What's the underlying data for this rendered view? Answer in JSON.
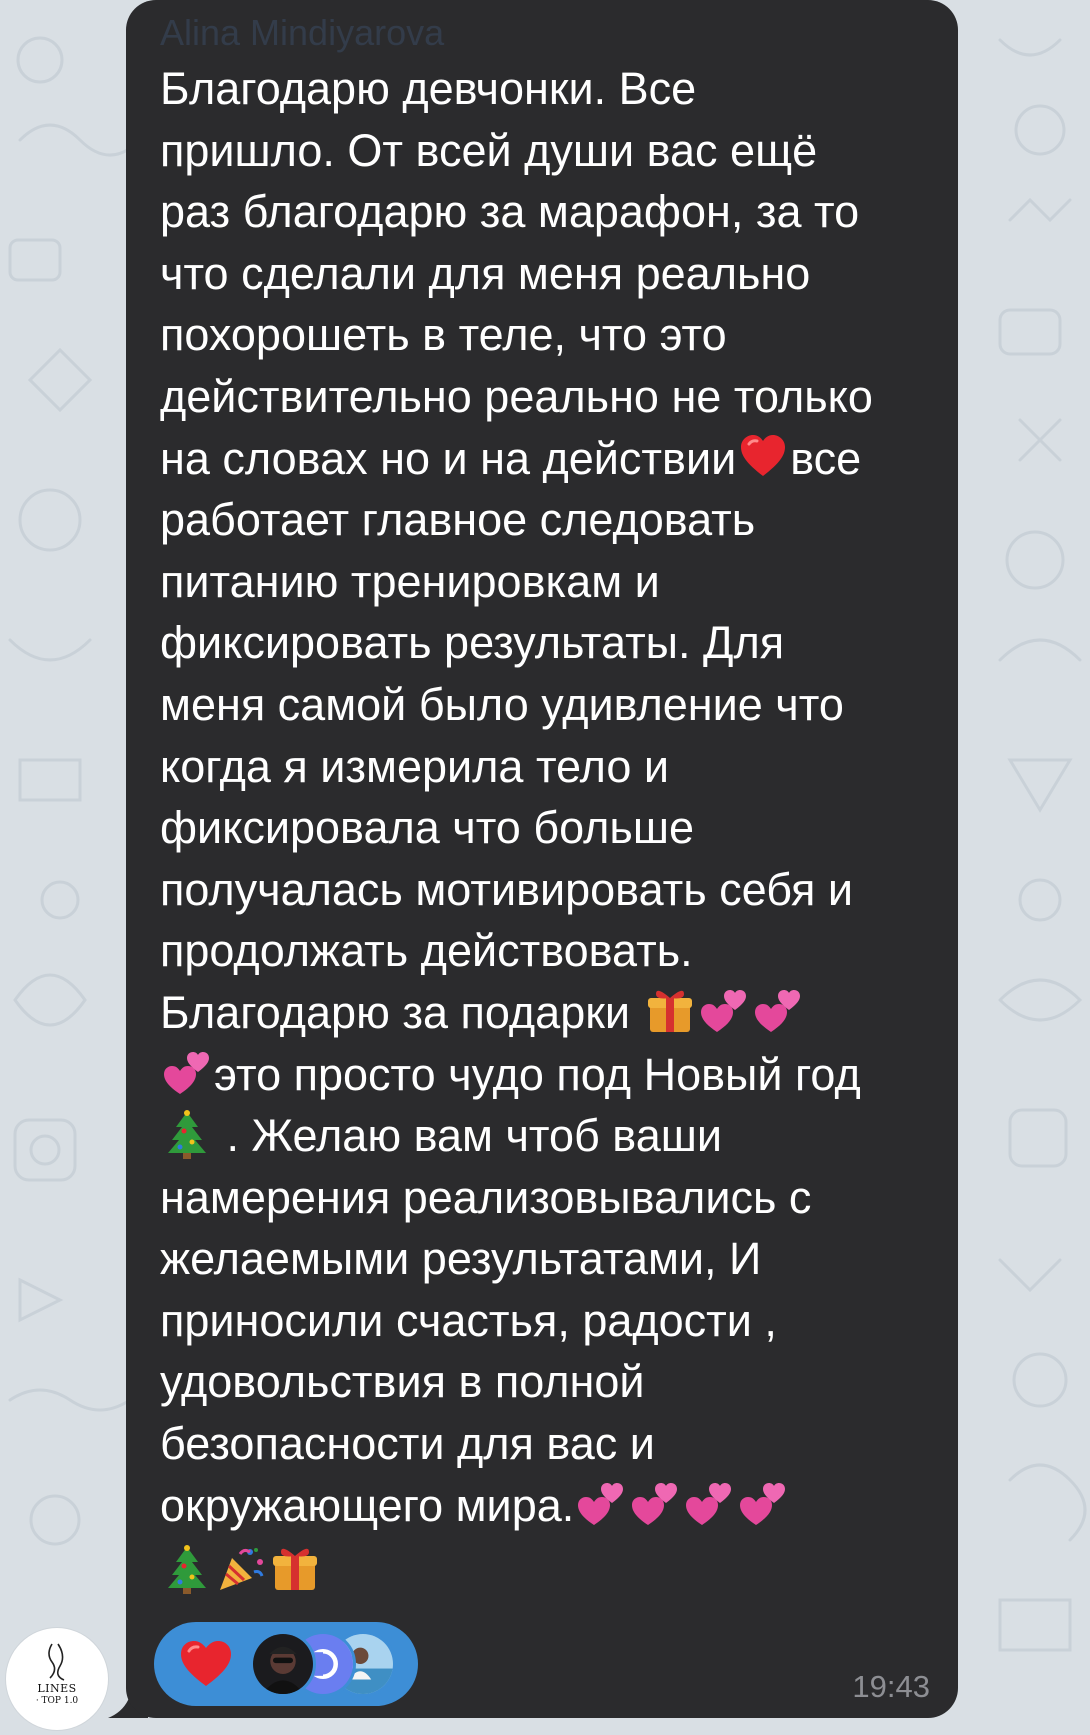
{
  "chat": {
    "sender_name": "Alina Mindiyarova",
    "message_lines": [
      "Благодарю девчонки. Все",
      "пришло. От всей души вас ещё",
      "раз благодарю за марафон, за то",
      "что сделали для меня реально",
      "похорошеть в теле, что это",
      "действительно реально не только",
      "на словах но и на действии",
      "все",
      "работает главное следовать",
      "питанию тренировкам и",
      "фиксировать результаты. Для",
      "меня самой было удивление что",
      "когда я измерила  тело и",
      "фиксировала что больше",
      "получалась мотивировать себя и",
      "продолжать действовать.",
      "Благодарю за подарки ",
      "это просто чудо под Новый год",
      " . Желаю вам чтоб ваши",
      "намерения реализовывались с",
      "желаемыми результатами,   И",
      "приносили счастья, радости  ,",
      "удовольствия в полной",
      "безопасности для вас и",
      "окружающего мира."
    ],
    "timestamp": "19:43",
    "reaction_emoji": "red-heart",
    "avatar_text": {
      "line1": "LINES",
      "line2": "· TOP 1.0"
    }
  },
  "colors": {
    "background": "#d9dfe4",
    "bubble": "#2b2b2d",
    "message_text": "#ffffff",
    "reaction_pill": "#3d8ed6",
    "timestamp": "#8d8e93"
  },
  "icons": {
    "inline_emoji": [
      "red-heart",
      "gift",
      "two-hearts",
      "christmas-tree",
      "party-popper"
    ]
  }
}
